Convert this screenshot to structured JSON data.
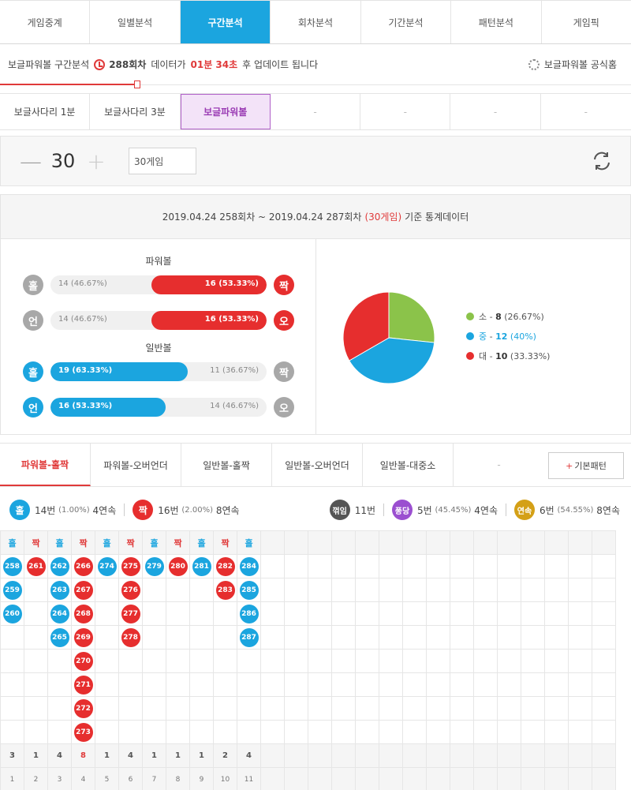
{
  "nav": {
    "tabs": [
      "게임중계",
      "일별분석",
      "구간분석",
      "회차분석",
      "기간분석",
      "패턴분석",
      "게임픽"
    ]
  },
  "info": {
    "prefix": "보글파워볼 구간분석",
    "round": "288회차",
    "mid": "데이터가",
    "time": "01분 34초",
    "suffix": "후 업데이트 됩니다",
    "official": "보글파워볼 공식홈"
  },
  "subtabs": [
    "보글사다리 1분",
    "보글사다리 3분",
    "보글파워볼",
    "-",
    "-",
    "-",
    "-"
  ],
  "counter": {
    "minus": "—",
    "value": "30",
    "plus": "+",
    "select": "30게임"
  },
  "stats": {
    "range": "2019.04.24 258회차 ~ 2019.04.24 287회차",
    "games": "(30게임)",
    "tail": "기준 통계데이터",
    "powerball_title": "파워볼",
    "normal_title": "일반볼",
    "rows": [
      {
        "left": "홀",
        "right": "짝",
        "left_val": "14 (46.67%)",
        "right_val": "16 (53.33%)"
      },
      {
        "left": "언",
        "right": "오",
        "left_val": "14 (46.67%)",
        "right_val": "16 (53.33%)"
      },
      {
        "left": "홀",
        "right": "짝",
        "left_val": "19 (63.33%)",
        "right_val": "11 (36.67%)"
      },
      {
        "left": "언",
        "right": "오",
        "left_val": "16 (53.33%)",
        "right_val": "14 (46.67%)"
      }
    ],
    "legend": [
      {
        "name": "소",
        "count": "8",
        "pct": "(26.67%)"
      },
      {
        "name": "중",
        "count": "12",
        "pct": "(40%)"
      },
      {
        "name": "대",
        "count": "10",
        "pct": "(33.33%)"
      }
    ],
    "colors": {
      "small": "#8bc34a",
      "mid": "#1ba5df",
      "large": "#e62e2e"
    }
  },
  "chart_data": {
    "type": "pie",
    "categories": [
      "소",
      "중",
      "대"
    ],
    "values": [
      8,
      12,
      10
    ]
  },
  "ptabs": {
    "items": [
      "파워볼-홀짝",
      "파워볼-오버언더",
      "일반볼-홀짝",
      "일반볼-오버언더",
      "일반볼-대중소",
      "-"
    ],
    "basic": "기본패턴",
    "basic_plus": "+"
  },
  "summary": {
    "odd": "홀",
    "odd_count": "14번",
    "odd_pct": "(1.00%)",
    "odd_streak": "4연속",
    "even": "짝",
    "even_count": "16번",
    "even_pct": "(2.00%)",
    "even_streak": "8연속",
    "break": "꺾임",
    "break_count": "11번",
    "pong": "퐁당",
    "pong_count": "5번",
    "pong_pct": "(45.45%)",
    "pong_streak": "4연속",
    "cont": "연속",
    "cont_count": "6번",
    "cont_pct": "(54.55%)",
    "cont_streak": "8연속"
  },
  "pattern": {
    "headers": [
      "홀",
      "짝",
      "홀",
      "짝",
      "홀",
      "짝",
      "홀",
      "짝",
      "홀",
      "짝",
      "홀"
    ],
    "columns": [
      [
        "258",
        "259",
        "260"
      ],
      [
        "261"
      ],
      [
        "262",
        "263",
        "264",
        "265"
      ],
      [
        "266",
        "267",
        "268",
        "269",
        "270",
        "271",
        "272",
        "273"
      ],
      [
        "274"
      ],
      [
        "275",
        "276",
        "277",
        "278"
      ],
      [
        "279"
      ],
      [
        "280"
      ],
      [
        "281"
      ],
      [
        "282",
        "283"
      ],
      [
        "284",
        "285",
        "286",
        "287"
      ]
    ],
    "counts": [
      "3",
      "1",
      "4",
      "8",
      "1",
      "4",
      "1",
      "1",
      "1",
      "2",
      "4"
    ],
    "indices": [
      "1",
      "2",
      "3",
      "4",
      "5",
      "6",
      "7",
      "8",
      "9",
      "10",
      "11"
    ]
  }
}
